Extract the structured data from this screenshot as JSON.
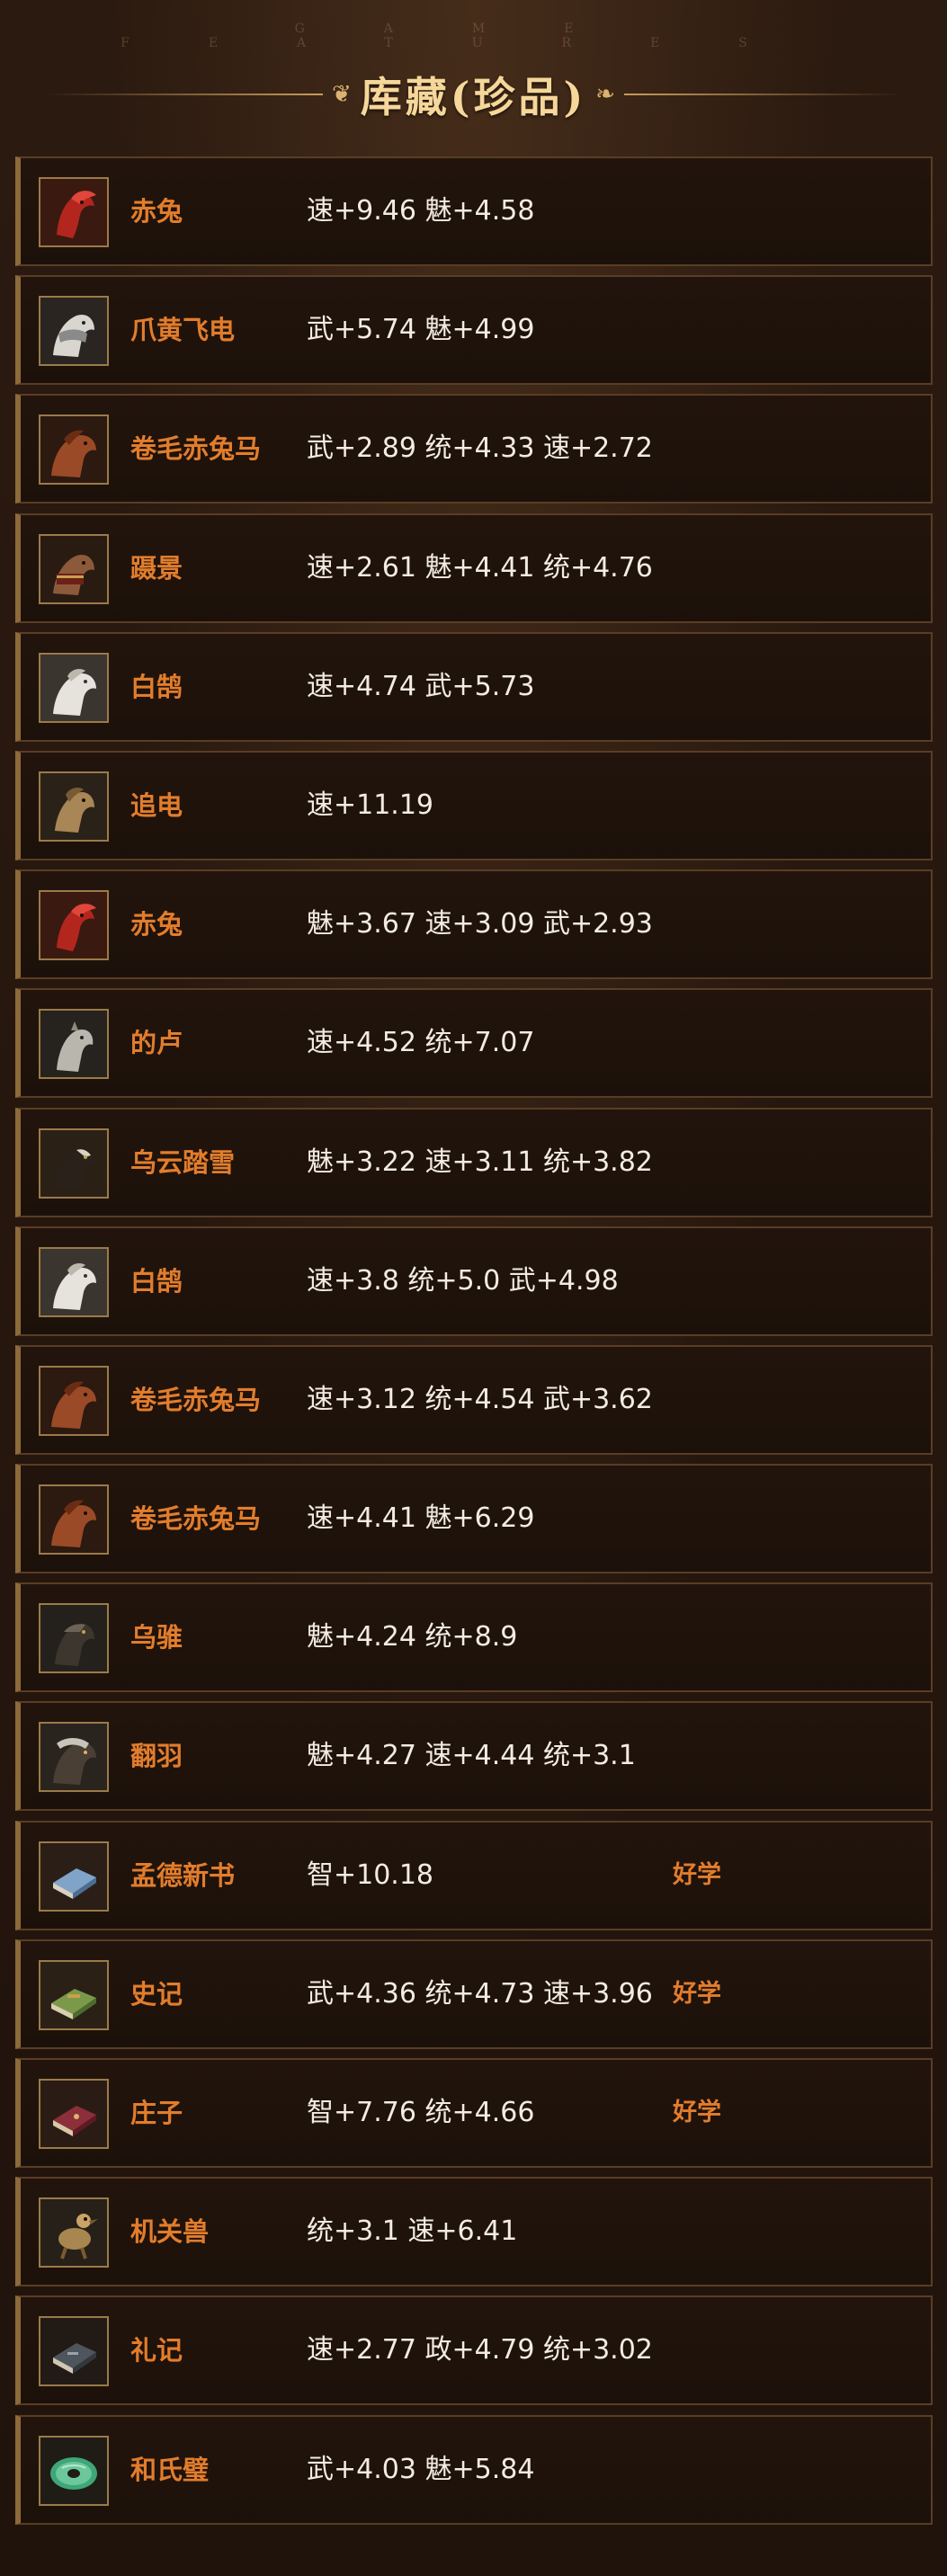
{
  "header": {
    "subtitle": "GAME FEATURES",
    "title": "库藏(珍品)"
  },
  "items": [
    {
      "name": "赤兔",
      "stats": "速+9.46 魅+4.58",
      "tag": "",
      "icon": "red-hare-horse-icon"
    },
    {
      "name": "爪黄飞电",
      "stats": "武+5.74 魅+4.99",
      "tag": "",
      "icon": "white-armored-horse-icon"
    },
    {
      "name": "卷毛赤兔马",
      "stats": "武+2.89 统+4.33 速+2.72",
      "tag": "",
      "icon": "curly-red-horse-icon"
    },
    {
      "name": "蹑景",
      "stats": "速+2.61 魅+4.41 统+4.76",
      "tag": "",
      "icon": "saddled-brown-horse-icon"
    },
    {
      "name": "白鹄",
      "stats": "速+4.74 武+5.73",
      "tag": "",
      "icon": "white-horse-icon"
    },
    {
      "name": "追电",
      "stats": "速+11.19",
      "tag": "",
      "icon": "bronze-horse-icon"
    },
    {
      "name": "赤兔",
      "stats": "魅+3.67 速+3.09 武+2.93",
      "tag": "",
      "icon": "red-hare-horse-icon"
    },
    {
      "name": "的卢",
      "stats": "速+4.52 统+7.07",
      "tag": "",
      "icon": "grey-horse-icon"
    },
    {
      "name": "乌云踏雪",
      "stats": "魅+3.22 速+3.11 统+3.82",
      "tag": "",
      "icon": "black-horse-icon"
    },
    {
      "name": "白鹄",
      "stats": "速+3.8 统+5.0 武+4.98",
      "tag": "",
      "icon": "white-horse-icon"
    },
    {
      "name": "卷毛赤兔马",
      "stats": "速+3.12 统+4.54 武+3.62",
      "tag": "",
      "icon": "curly-red-horse-icon"
    },
    {
      "name": "卷毛赤兔马",
      "stats": "速+4.41 魅+6.29",
      "tag": "",
      "icon": "curly-red-horse-icon"
    },
    {
      "name": "乌骓",
      "stats": "魅+4.24 统+8.9",
      "tag": "",
      "icon": "dark-horse-icon"
    },
    {
      "name": "翻羽",
      "stats": "魅+4.27 速+4.44 统+3.1",
      "tag": "",
      "icon": "armored-dark-horse-icon"
    },
    {
      "name": "孟德新书",
      "stats": "智+10.18",
      "tag": "好学",
      "icon": "book-icon"
    },
    {
      "name": "史记",
      "stats": "武+4.36 统+4.73 速+3.96",
      "tag": "好学",
      "icon": "scroll-book-icon"
    },
    {
      "name": "庄子",
      "stats": "智+7.76 统+4.66",
      "tag": "好学",
      "icon": "red-book-icon"
    },
    {
      "name": "机关兽",
      "stats": "统+3.1 速+6.41",
      "tag": "",
      "icon": "mechanical-beast-icon"
    },
    {
      "name": "礼记",
      "stats": "速+2.77 政+4.79 统+3.02",
      "tag": "",
      "icon": "dark-book-icon"
    },
    {
      "name": "和氏璧",
      "stats": "武+4.03 魅+5.84",
      "tag": "",
      "icon": "jade-disc-icon"
    }
  ]
}
